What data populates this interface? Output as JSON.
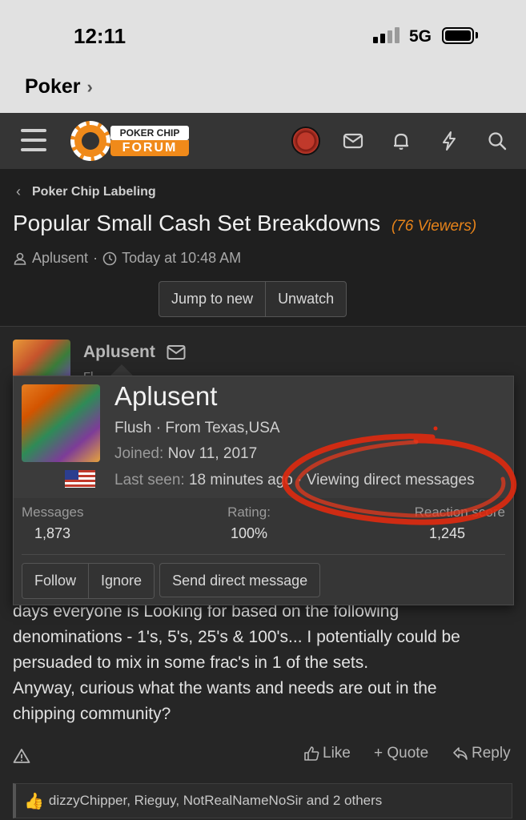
{
  "status_bar": {
    "time": "12:11",
    "network": "5G",
    "back_app": "Poker"
  },
  "header": {
    "logo_top": "POKER CHIP",
    "logo_bottom": "FORUM"
  },
  "breadcrumb": {
    "label": "Poker Chip Labeling"
  },
  "thread": {
    "title": "Popular Small Cash Set Breakdowns",
    "viewers": "(76 Viewers)",
    "author": "Aplusent",
    "date": "Today at 10:48 AM",
    "jump_label": "Jump to new",
    "unwatch_label": "Unwatch"
  },
  "post": {
    "author": "Aplusent",
    "author_sub": "Fl",
    "body_lines": [
      "days everyone is Looking for based on the following",
      "denominations - 1's, 5's, 25's & 100's... I potentially could be",
      "persuaded to mix in some frac's in 1 of the sets.",
      "Anyway, curious what the wants and needs are out in the",
      "chipping community?"
    ],
    "like_label": "Like",
    "quote_label": "+ Quote",
    "reply_label": "Reply",
    "reactions_text": "dizzyChipper, Rieguy, NotRealNameNoSir and 2 others"
  },
  "tooltip": {
    "name": "Aplusent",
    "title_location": "Flush · From Texas,USA",
    "joined_label": "Joined:",
    "joined_value": "Nov 11, 2017",
    "last_seen_label": "Last seen:",
    "last_seen_value": "18 minutes ago · Viewing direct messages",
    "stats": [
      {
        "label": "Messages",
        "value": "1,873"
      },
      {
        "label": "Rating:",
        "value": "100%"
      },
      {
        "label": "Reaction score",
        "value": "1,245"
      }
    ],
    "follow_label": "Follow",
    "ignore_label": "Ignore",
    "dm_label": "Send direct message"
  },
  "colors": {
    "accent": "#e8841a",
    "annotation": "#e02a10"
  }
}
